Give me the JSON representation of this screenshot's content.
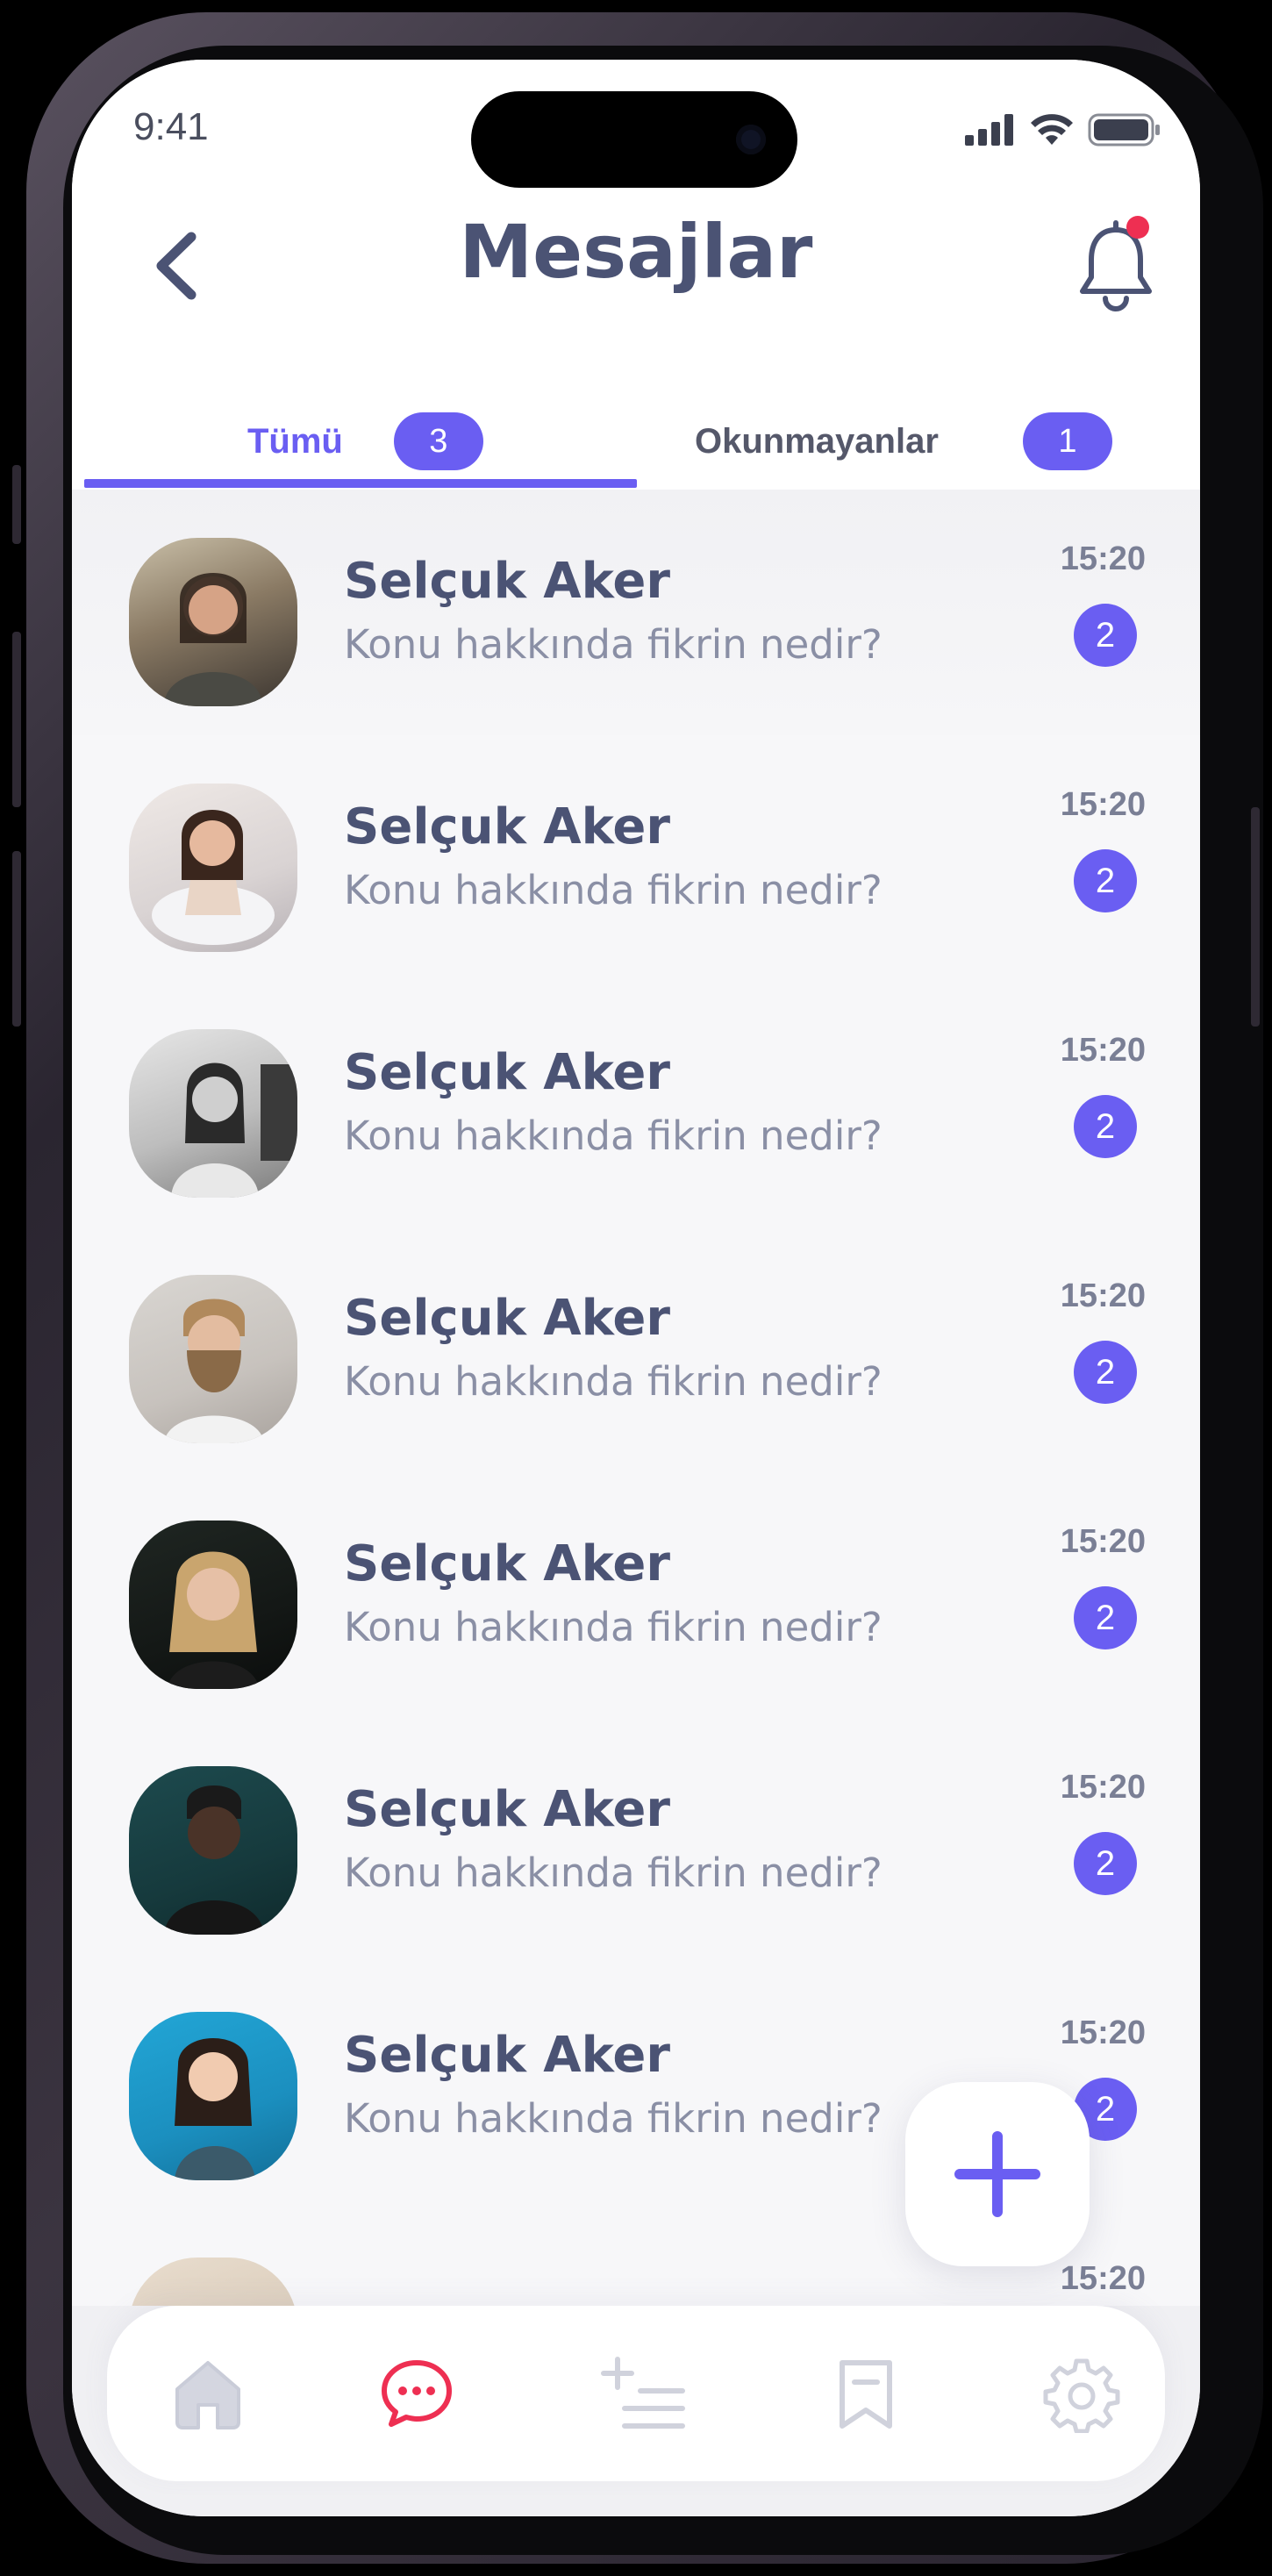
{
  "status_bar": {
    "time": "9:41"
  },
  "header": {
    "title": "Mesajlar",
    "has_notification": true
  },
  "tabs": [
    {
      "label": "Tümü",
      "count": "3",
      "active": true
    },
    {
      "label": "Okunmayanlar",
      "count": "1",
      "active": false
    }
  ],
  "conversations": [
    {
      "name": "Selçuk Aker",
      "message": "Konu hakkında fikrin nedir?",
      "time": "15:20",
      "unread": "2"
    },
    {
      "name": "Selçuk Aker",
      "message": "Konu hakkında fikrin nedir?",
      "time": "15:20",
      "unread": "2"
    },
    {
      "name": "Selçuk Aker",
      "message": "Konu hakkında fikrin nedir?",
      "time": "15:20",
      "unread": "2"
    },
    {
      "name": "Selçuk Aker",
      "message": "Konu hakkında fikrin nedir?",
      "time": "15:20",
      "unread": "2"
    },
    {
      "name": "Selçuk Aker",
      "message": "Konu hakkında fikrin nedir?",
      "time": "15:20",
      "unread": "2"
    },
    {
      "name": "Selçuk Aker",
      "message": "Konu hakkında fikrin nedir?",
      "time": "15:20",
      "unread": "2"
    },
    {
      "name": "Selçuk Aker",
      "message": "Konu hakkında fikrin nedir?",
      "time": "15:20",
      "unread": "2"
    },
    {
      "name": "",
      "message": "",
      "time": "15:20",
      "unread": ""
    }
  ],
  "bottom_nav": [
    {
      "icon": "home-icon",
      "active": false
    },
    {
      "icon": "chat-bubble-icon",
      "active": true
    },
    {
      "icon": "add-list-icon",
      "active": false
    },
    {
      "icon": "bookmark-icon",
      "active": false
    },
    {
      "icon": "gear-icon",
      "active": false
    }
  ],
  "colors": {
    "accent": "#6a5ef2",
    "title": "#4b5374",
    "subtitle": "#8a8fa5",
    "active_nav": "#ee2f52",
    "notification_dot": "#ee2f52"
  }
}
